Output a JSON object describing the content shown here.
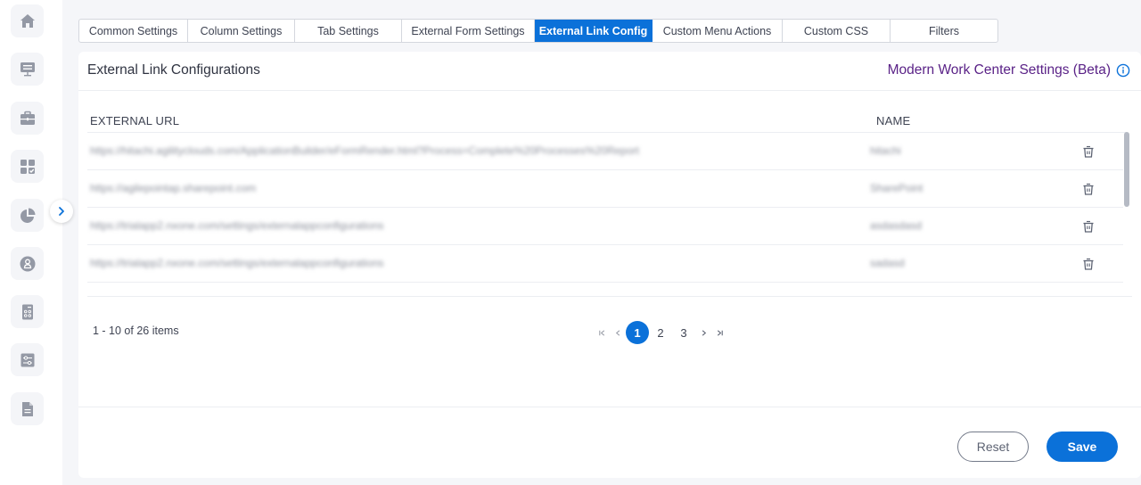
{
  "sidebar": {
    "items": [
      {
        "name": "home",
        "icon": "home-icon"
      },
      {
        "name": "monitor-list",
        "icon": "monitor-list-icon"
      },
      {
        "name": "briefcase",
        "icon": "briefcase-icon"
      },
      {
        "name": "dashboard",
        "icon": "dashboard-check-icon"
      },
      {
        "name": "reports",
        "icon": "pie-chart-icon"
      },
      {
        "name": "user",
        "icon": "user-icon"
      },
      {
        "name": "calculator",
        "icon": "calculator-icon"
      },
      {
        "name": "settings-sliders",
        "icon": "sliders-icon"
      },
      {
        "name": "document",
        "icon": "document-icon"
      }
    ],
    "expand_icon": "chevron-right-icon"
  },
  "tabs": [
    {
      "label": "Common Settings",
      "active": false
    },
    {
      "label": "Column Settings",
      "active": false
    },
    {
      "label": "Tab Settings",
      "active": false
    },
    {
      "label": "External Form Settings",
      "active": false
    },
    {
      "label": "External Link Config",
      "active": true
    },
    {
      "label": "Custom Menu Actions",
      "active": false
    },
    {
      "label": "Custom CSS",
      "active": false
    },
    {
      "label": "Filters",
      "active": false
    }
  ],
  "card": {
    "title": "External Link Configurations",
    "beta_title": "Modern Work Center Settings (Beta)",
    "info_icon": "info-icon"
  },
  "table": {
    "columns": [
      "EXTERNAL URL",
      "NAME"
    ],
    "rows": [
      {
        "url": "https://hitachi.agilityclouds.com/ApplicationBuilder/eFormRender.html?Process=Complete%20Processes%20Report",
        "name": "hitachi"
      },
      {
        "url": "https://agilepointap.sharepoint.com",
        "name": "SharePoint"
      },
      {
        "url": "https://trialapp2.nxone.com/settings/externalappconfigurations",
        "name": "asdasdasd"
      },
      {
        "url": "https://trialapp2.nxone.com/settings/externalappconfigurations",
        "name": "sadasd"
      }
    ],
    "row_action_icon": "trash-icon"
  },
  "pagination": {
    "info": "1 - 10 of 26 items",
    "first": "⇤",
    "prev": "‹",
    "pages": [
      "1",
      "2",
      "3"
    ],
    "current_page": "1",
    "next": "›",
    "last": "⇥"
  },
  "actions": {
    "reset_label": "Reset",
    "save_label": "Save"
  },
  "colors": {
    "accent": "#0b71d9",
    "beta_title": "#5a2287",
    "icon_gray": "#9499a5"
  }
}
